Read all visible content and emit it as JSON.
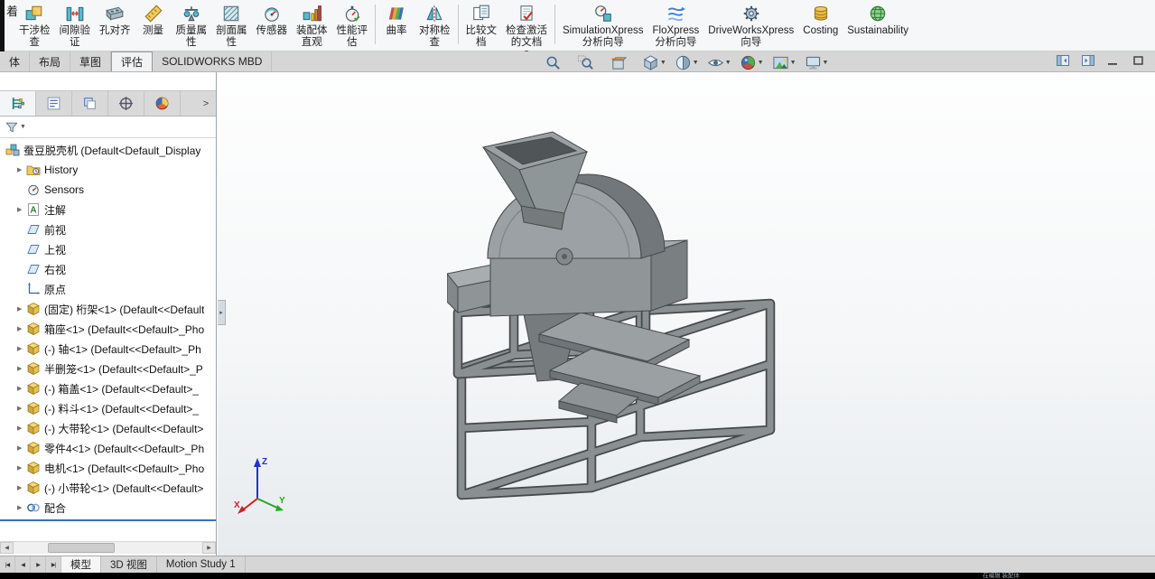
{
  "ui": {
    "caret": "▼",
    "expand_arrow": "▶",
    "panel_handle": "▸",
    "scroll_left": "◀",
    "scroll_right": "▶"
  },
  "colors": {
    "accent_blue": "#3a6ec0",
    "statusbar": "#000000",
    "viewport_top": "#fefefe",
    "viewport_bottom": "#e7ebee",
    "model_gray": "#909597"
  },
  "header": {
    "edge_char": "着"
  },
  "ribbon": {
    "items": [
      {
        "label": "干涉检\n查",
        "icon": "ic-interference"
      },
      {
        "label": "间隙验\n证",
        "icon": "ic-clearance"
      },
      {
        "label": "孔对齐",
        "icon": "ic-hole"
      },
      {
        "label": "测量",
        "icon": "ic-measure"
      },
      {
        "label": "质量属\n性",
        "icon": "ic-mass"
      },
      {
        "label": "剖面属\n性",
        "icon": "ic-sectionprops"
      },
      {
        "label": "传感器",
        "icon": "ic-sensor"
      },
      {
        "label": "装配体\n直观",
        "icon": "ic-visualize"
      },
      {
        "label": "性能评\n估",
        "icon": "ic-performance"
      },
      {
        "type": "sep"
      },
      {
        "label": "曲率",
        "icon": "ic-curvature"
      },
      {
        "label": "对称检\n查",
        "icon": "ic-symmetry"
      },
      {
        "type": "sep"
      },
      {
        "label": "比较文\n档",
        "icon": "ic-compare"
      },
      {
        "label": "检查激活\n的文档",
        "icon": "ic-checkdoc",
        "dropdown": true
      },
      {
        "type": "sep"
      },
      {
        "label": "SimulationXpress\n分析向导",
        "icon": "ic-simx"
      },
      {
        "label": "FloXpress\n分析向导",
        "icon": "ic-flox"
      },
      {
        "label": "DriveWorksXpress\n向导",
        "icon": "ic-dwx"
      },
      {
        "label": "Costing",
        "icon": "ic-costing"
      },
      {
        "label": "Sustainability",
        "icon": "ic-sustain"
      }
    ]
  },
  "command_tabs": [
    {
      "label": "体"
    },
    {
      "label": "布局"
    },
    {
      "label": "草图"
    },
    {
      "label": "评估",
      "active": true
    },
    {
      "label": "SOLIDWORKS MBD"
    }
  ],
  "viewbar": {
    "items": [
      {
        "icon": "vb-zoomfit"
      },
      {
        "icon": "vb-zoomarea"
      },
      {
        "icon": "vb-section"
      },
      {
        "icon": "vb-orient",
        "dropdown": true
      },
      {
        "icon": "vb-display",
        "dropdown": true
      },
      {
        "icon": "vb-hideshow",
        "dropdown": true
      },
      {
        "icon": "vb-appearance",
        "dropdown": true
      },
      {
        "icon": "vb-scene",
        "dropdown": true
      },
      {
        "icon": "vb-viewsettings",
        "dropdown": true
      }
    ]
  },
  "window_icons": [
    {
      "icon": "wi-collapseL"
    },
    {
      "icon": "wi-collapseR"
    },
    {
      "icon": "wi-min"
    },
    {
      "icon": "wi-restore"
    }
  ],
  "panel": {
    "chevron": ">",
    "filter_caret": "▼",
    "tabs": [
      {
        "icon": "pt-tree",
        "active": true
      },
      {
        "icon": "pt-props"
      },
      {
        "icon": "pt-config"
      },
      {
        "icon": "pt-dimx"
      },
      {
        "icon": "pt-display"
      }
    ]
  },
  "tree": {
    "items": [
      {
        "type": "root",
        "icon": "tr-assembly",
        "label": "蚕豆脱壳机 (Default<Default_Display",
        "ind": 0
      },
      {
        "icon": "tr-history",
        "label": "History",
        "arrow": true,
        "ind": 1
      },
      {
        "icon": "tr-sensors",
        "label": "Sensors",
        "ind": 1
      },
      {
        "icon": "tr-ann",
        "label": "注解",
        "arrow": true,
        "ind": 1
      },
      {
        "icon": "tr-plane",
        "label": "前视",
        "ind": 1
      },
      {
        "icon": "tr-plane",
        "label": "上视",
        "ind": 1
      },
      {
        "icon": "tr-plane",
        "label": "右视",
        "ind": 1
      },
      {
        "icon": "tr-origin",
        "label": "原点",
        "ind": 1
      },
      {
        "icon": "tr-part",
        "label": "(固定) 桁架<1> (Default<<Default",
        "arrow": true,
        "ind": 1
      },
      {
        "icon": "tr-part",
        "label": "箱座<1> (Default<<Default>_Pho",
        "arrow": true,
        "ind": 1
      },
      {
        "icon": "tr-part",
        "label": "(-) 轴<1> (Default<<Default>_Ph",
        "arrow": true,
        "ind": 1
      },
      {
        "icon": "tr-part",
        "label": "半删笼<1> (Default<<Default>_P",
        "arrow": true,
        "ind": 1
      },
      {
        "icon": "tr-part",
        "label": "(-) 箱盖<1> (Default<<Default>_",
        "arrow": true,
        "ind": 1
      },
      {
        "icon": "tr-part",
        "label": "(-) 料斗<1> (Default<<Default>_",
        "arrow": true,
        "ind": 1
      },
      {
        "icon": "tr-part",
        "label": "(-) 大带轮<1> (Default<<Default>",
        "arrow": true,
        "ind": 1
      },
      {
        "icon": "tr-part",
        "label": "零件4<1> (Default<<Default>_Ph",
        "arrow": true,
        "ind": 1
      },
      {
        "icon": "tr-part",
        "label": "电机<1> (Default<<Default>_Pho",
        "arrow": true,
        "ind": 1
      },
      {
        "icon": "tr-part",
        "label": "(-) 小带轮<1> (Default<<Default>",
        "arrow": true,
        "ind": 1
      },
      {
        "icon": "tr-mates",
        "label": "配合",
        "arrow": true,
        "ind": 1
      }
    ]
  },
  "triad": {
    "x": "X",
    "y": "Y",
    "z": "Z"
  },
  "bottom": {
    "nav": [
      {
        "label": "|◀"
      },
      {
        "label": "◀"
      },
      {
        "label": "▶"
      },
      {
        "label": "▶|"
      }
    ],
    "tabs": [
      {
        "label": "模型",
        "active": true
      },
      {
        "label": "3D 视图"
      },
      {
        "label": "Motion Study 1"
      }
    ]
  },
  "statusbar": {
    "right_text": "在编辑 装配体"
  }
}
